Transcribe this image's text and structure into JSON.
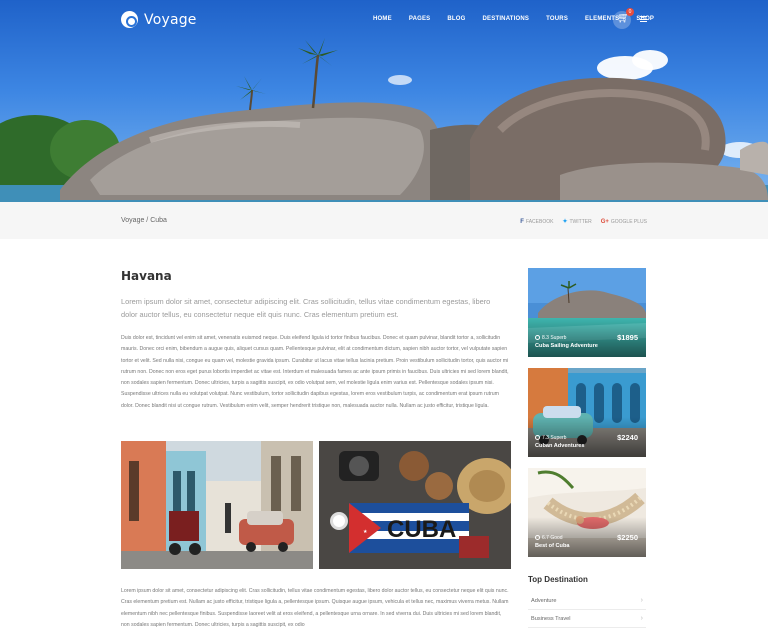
{
  "brand": {
    "name": "Voyage",
    "icon": "camera-icon"
  },
  "nav": [
    "HOME",
    "PAGES",
    "BLOG",
    "DESTINATIONS",
    "TOURS",
    "ELEMENTS",
    "SHOP"
  ],
  "cart": {
    "icon": "cart-icon",
    "count": "0"
  },
  "breadcrumb": "Voyage / Cuba",
  "share": {
    "facebook": "FACEBOOK",
    "twitter": "TWITTER",
    "google": "GOOGLE PLUS"
  },
  "article": {
    "title": "Havana",
    "lead": "Lorem ipsum dolor sit amet, consectetur adipiscing elit. Cras sollicitudin, tellus vitae condimentum egestas, libero dolor auctor tellus, eu consectetur neque elit quis nunc. Cras elementum pretium est.",
    "body": "Duis dolor est, tincidunt vel enim sit amet, venenatis euismod neque. Duis eleifend ligula id tortor finibus faucibus. Donec et quam pulvinar, blandit tortor a, sollicitudin mauris. Donec orci enim, bibendum a augue quis, aliquet cursus quam. Pellentesque pulvinar, elit at condimentum dictum, sapien nibh auctor tortor, vel vulputate sapien tortor et velit. Sed nulla nisi, congue eu quam vel, molestie gravida ipsum. Curabitur ut lacus vitae tellus lacinia pretium. Proin vestibulum sollicitudin tortor, quis auctor mi rutrum non. Donec non eros eget purus lobortis imperdiet ac vitae est. Interdum et malesuada fames ac ante ipsum primis in faucibus. Duis ultricies mi sed lorem blandit, non sodales sapien fermentum. Donec ultricies, turpis a sagittis suscipit, ex odio volutpat sem, vel molestie ligula enim varius est. Pellentesque sodales ipsum nisi. Suspendisse ultrices nulla eu volutpat volutpat. Nunc vestibulum, tortor sollicitudin dapibus egestas, lorem eros vestibulum turpis, ac condimentum erat ipsum rutrum dolor. Donec blandit nisi ut congue rutrum. Vestibulum enim velit, semper hendrerit tristique non, malesuada auctor nulla. Nullam ac justo efficitur, tristique ligula.",
    "photo_right_text": "CUBA",
    "body2": "Lorem ipsum dolor sit amet, consectetur adipiscing elit. Cras sollicitudin, tellus vitae condimentum egestas, libero dolor auctor tellus, eu consectetur neque elit quis nunc. Cras elementum pretium est. Nullam ac justo efficitur, tristique ligula a, pellentesque ipsum. Quisque augue ipsum, vehicula et tellus nec, maximus viverra metus. Nullam elementum nibh nec pellentesque finibus. Suspendisse laoreet velit at eros eleifend, a pellentesque urna ornare. In sed viverra dui. Duis ultricies mi sed lorem blandit, non sodales sapien fermentum. Donec ultricies, turpis a sagittis suscipit, ex odio"
  },
  "tours": [
    {
      "rating": "8.3 Superb",
      "name": "Cuba Sailing Adventure",
      "price": "$1895"
    },
    {
      "rating": "7.3 Superb",
      "name": "Cuban Adventures",
      "price": "$2240"
    },
    {
      "rating": "6.7 Good",
      "name": "Best of Cuba",
      "price": "$2250"
    }
  ],
  "sidebar": {
    "top_destination_title": "Top Destination",
    "destinations": [
      "Adventure",
      "Business Travel"
    ]
  },
  "colors": {
    "accent": "#2b74d8",
    "sky": "#3d86e3"
  }
}
